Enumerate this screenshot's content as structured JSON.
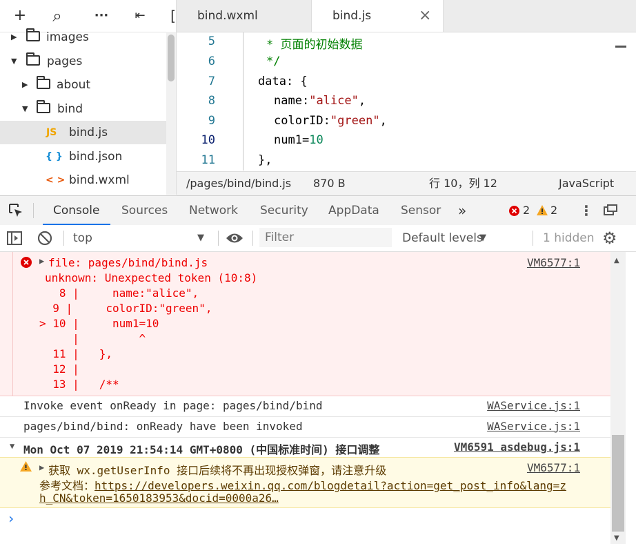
{
  "tree": {
    "toolbar": {
      "add": "+",
      "search": "⌕",
      "more": "···",
      "outdent": "⇤",
      "bracket": "["
    },
    "items": [
      {
        "label": "images",
        "type": "folder",
        "expanded": false
      },
      {
        "label": "pages",
        "type": "folder",
        "expanded": true
      },
      {
        "label": "about",
        "type": "folder",
        "expanded": false
      },
      {
        "label": "bind",
        "type": "folder",
        "expanded": true
      },
      {
        "label": "bind.js",
        "type": "js",
        "icon": "JS",
        "selected": true
      },
      {
        "label": "bind.json",
        "type": "json",
        "icon": "{ }"
      },
      {
        "label": "bind.wxml",
        "type": "wxml",
        "icon": "< >"
      }
    ]
  },
  "editor": {
    "tabs": [
      {
        "label": "bind.wxml",
        "active": false
      },
      {
        "label": "bind.js",
        "active": true,
        "close": "×"
      }
    ],
    "line_numbers": [
      "5",
      "6",
      "7",
      "8",
      "9",
      "10",
      "11"
    ],
    "code": {
      "l5": "* 页面的初始数据",
      "l6": "*/",
      "l7_key": "data",
      "l7_rest": ": {",
      "l8_key": "name",
      "l8_str": "\"alice\"",
      "l9_key": "colorID",
      "l9_str": "\"green\"",
      "l10_key": "num1",
      "l10_num": "10",
      "l11": "},",
      "colon": ":",
      "comma": ",",
      "eq": "="
    }
  },
  "status": {
    "path": "/pages/bind/bind.js",
    "size": "870 B",
    "position": "行 10，列 12",
    "language": "JavaScript"
  },
  "devtools": {
    "tabs": [
      "Console",
      "Sources",
      "Network",
      "Security",
      "AppData",
      "Sensor"
    ],
    "active_tab": "Console",
    "more": "»",
    "errors": "2",
    "warnings": "2",
    "context": "top",
    "filter_placeholder": "Filter",
    "levels": "Default levels",
    "hidden": "1 hidden"
  },
  "console": {
    "error": {
      "title": "file: pages/bind/bind.js",
      "message": "unknown: Unexpected token (10:8)",
      "lines": [
        "   8 |     name:\"alice\",",
        "  9 |     colorID:\"green\",",
        "> 10 |     num1=10",
        "     |         ^",
        "  11 |   },",
        "  12 |",
        "  13 |   /**"
      ],
      "source": "VM6577:1"
    },
    "log1": {
      "text": "Invoke event onReady in page: pages/bind/bind",
      "source": "WAService.js:1"
    },
    "log2": {
      "text": "pages/bind/bind: onReady have been invoked",
      "source": "WAService.js:1"
    },
    "group": {
      "text": "Mon Oct 07 2019 21:54:14 GMT+0800 (中国标准时间) 接口调整",
      "source": "VM6591 asdebug.js:1"
    },
    "warn": {
      "line1": "获取 wx.getUserInfo 接口后续将不再出现授权弹窗，请注意升级",
      "line2_prefix": "参考文档：",
      "line2_link": "https://developers.weixin.qq.com/blogdetail?action=get_post_info&lang=z",
      "line3": "h_CN&token=1650183953&docid=0000a26…",
      "source": "VM6577:1"
    },
    "prompt": "›"
  },
  "colors": {
    "accent": "#1a73e8",
    "error": "#e00000",
    "warning": "#f5a623",
    "comment": "#008000",
    "string": "#a31515",
    "number": "#098658"
  }
}
